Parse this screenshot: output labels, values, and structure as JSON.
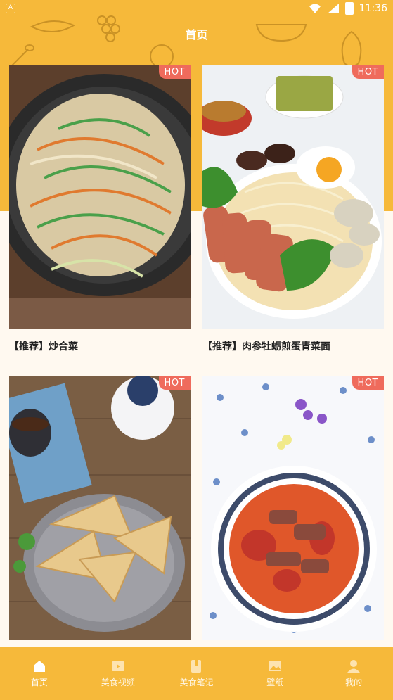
{
  "status_bar": {
    "time": "11:36"
  },
  "header": {
    "title": "首页"
  },
  "cards": [
    {
      "badge": "HOT",
      "title": "【推荐】炒合菜"
    },
    {
      "badge": "HOT",
      "title": "【推荐】肉参牡蛎煎蛋青菜面"
    },
    {
      "badge": "HOT",
      "title": ""
    },
    {
      "badge": "HOT",
      "title": ""
    }
  ],
  "bottom_nav": {
    "items": [
      {
        "label": "首页",
        "icon": "home-icon",
        "active": true
      },
      {
        "label": "美食视频",
        "icon": "video-icon",
        "active": false
      },
      {
        "label": "美食笔记",
        "icon": "notebook-icon",
        "active": false
      },
      {
        "label": "壁纸",
        "icon": "image-icon",
        "active": false
      },
      {
        "label": "我的",
        "icon": "user-icon",
        "active": false
      }
    ]
  },
  "colors": {
    "accent": "#f6b93a",
    "hot": "#ef6b5c"
  }
}
